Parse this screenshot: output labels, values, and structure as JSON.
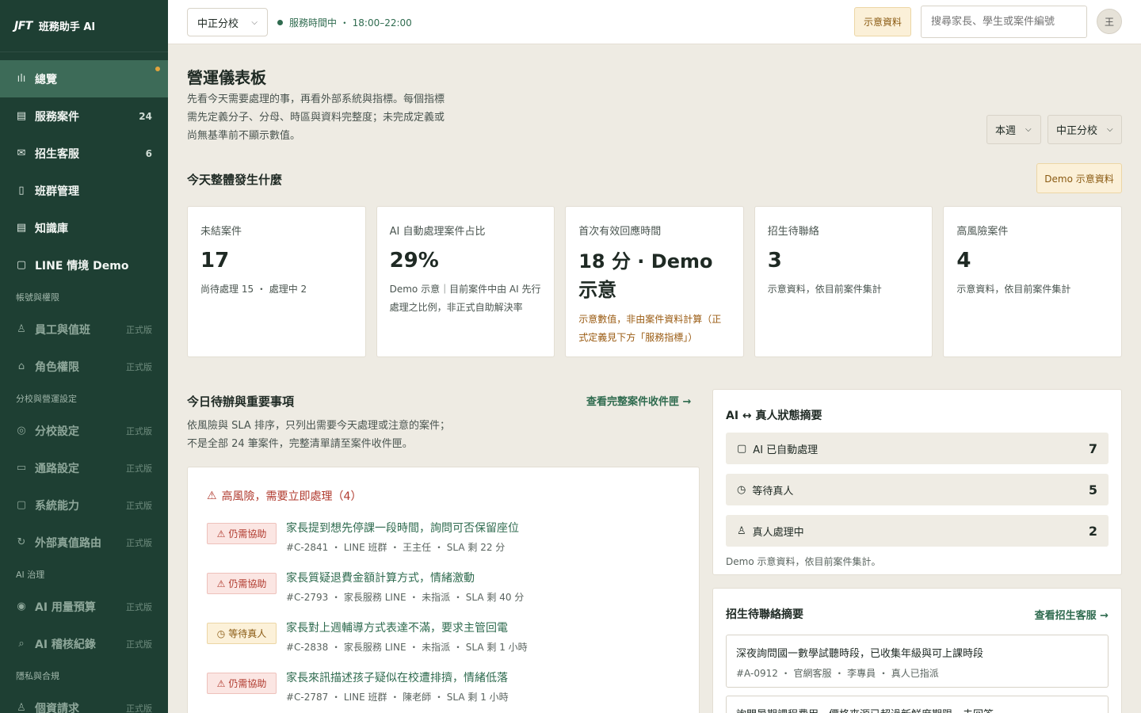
{
  "brand": {
    "logo": "JFT",
    "name": "班務助手 AI"
  },
  "nav": {
    "main": [
      {
        "icon": "ılı",
        "label": "總覽",
        "count": "",
        "active": true
      },
      {
        "icon": "▤",
        "label": "服務案件",
        "count": "24"
      },
      {
        "icon": "✉",
        "label": "招生客服",
        "count": "6"
      },
      {
        "icon": "▯",
        "label": "班群管理",
        "count": ""
      },
      {
        "icon": "▤",
        "label": "知識庫",
        "count": ""
      },
      {
        "icon": "▢",
        "label": "LINE 情境 Demo",
        "count": ""
      }
    ],
    "section_account": "帳號與權限",
    "account": [
      {
        "icon": "♙",
        "label": "員工與值班",
        "tag": "正式版"
      },
      {
        "icon": "🔒",
        "label": "角色權限",
        "tag": "正式版"
      }
    ],
    "section_branch": "分校與營運設定",
    "branch": [
      {
        "icon": "◎",
        "label": "分校設定",
        "tag": "正式版"
      },
      {
        "icon": "▭",
        "label": "通路設定",
        "tag": "正式版"
      },
      {
        "icon": "▢",
        "label": "系統能力",
        "tag": "正式版"
      },
      {
        "icon": "↻",
        "label": "外部真值路由",
        "tag": "正式版"
      }
    ],
    "section_ai": "AI 治理",
    "ai": [
      {
        "icon": "◉",
        "label": "AI 用量預算",
        "tag": "正式版"
      },
      {
        "icon": "⌕",
        "label": "AI 稽核紀錄",
        "tag": "正式版"
      }
    ],
    "section_privacy": "隱私與合規",
    "privacy": [
      {
        "icon": "♙",
        "label": "個資請求",
        "tag": "正式版"
      }
    ]
  },
  "topbar": {
    "branch": "中正分校",
    "service_status": "服務時間中 ・ 18:00–22:00",
    "demo_label": "示意資料",
    "search_placeholder": "搜尋家長、學生或案件編號",
    "avatar": "王"
  },
  "page": {
    "title": "營運儀表板",
    "desc": "先看今天需要處理的事，再看外部系統與指標。每個指標需先定義分子、分母、時區與資料完整度；未完成定義或尚無基準前不顯示數值。",
    "filter_week": "本週",
    "filter_branch": "中正分校"
  },
  "today": {
    "title": "今天整體發生什麼",
    "demo_tag": "Demo 示意資料",
    "kpis": [
      {
        "label": "未結案件",
        "value": "17",
        "note": "尚待處理 15 ・ 處理中 2"
      },
      {
        "label": "AI 自動處理案件占比",
        "value": "29%",
        "note": "Demo 示意｜目前案件中由 AI 先行處理之比例，非正式自助解決率"
      },
      {
        "label": "首次有效回應時間",
        "value": "18 分 · Demo 示意",
        "note": "示意數值，非由案件資料計算（正式定義見下方「服務指標」）"
      },
      {
        "label": "招生待聯絡",
        "value": "3",
        "note": "示意資料，依目前案件集計"
      },
      {
        "label": "高風險案件",
        "value": "4",
        "note": "示意資料，依目前案件集計"
      }
    ]
  },
  "todo": {
    "title": "今日待辦與重要事項",
    "link": "查看完整案件收件匣 →",
    "desc": "依風險與 SLA 排序，只列出需要今天處理或注意的案件；不是全部 24 筆案件，完整清單請至案件收件匣。",
    "risk_head": "高風險，需要立即處理（4）",
    "cases": [
      {
        "badge": "仍需協助",
        "badge_icon": "⚠",
        "type": "danger",
        "title": "家長提到想先停課一段時間，詢問可否保留座位",
        "meta": "#C-2841 ・ LINE 班群 ・ 王主任 ・ SLA 剩 22 分"
      },
      {
        "badge": "仍需協助",
        "badge_icon": "⚠",
        "type": "danger",
        "title": "家長質疑退費金額計算方式，情緒激動",
        "meta": "#C-2793 ・ 家長服務 LINE ・ 未指派 ・ SLA 剩 40 分"
      },
      {
        "badge": "等待真人",
        "badge_icon": "◷",
        "type": "wait",
        "title": "家長對上週輔導方式表達不滿，要求主管回電",
        "meta": "#C-2838 ・ 家長服務 LINE ・ 未指派 ・ SLA 剩 1 小時"
      },
      {
        "badge": "仍需協助",
        "badge_icon": "⚠",
        "type": "danger",
        "title": "家長來訊描述孩子疑似在校遭排擠，情緒低落",
        "meta": "#C-2787 ・ LINE 班群 ・ 陳老師 ・ SLA 剩 1 小時"
      }
    ]
  },
  "ai_summary": {
    "title": "AI ↔ 真人狀態摘要",
    "rows": [
      {
        "icon": "▢",
        "label": "AI 已自動處理",
        "value": "7"
      },
      {
        "icon": "◷",
        "label": "等待真人",
        "value": "5"
      },
      {
        "icon": "♙",
        "label": "真人處理中",
        "value": "2"
      }
    ],
    "foot": "Demo 示意資料，依目前案件集計。"
  },
  "enroll": {
    "title": "招生待聯絡摘要",
    "link": "查看招生客服 →",
    "items": [
      {
        "title": "深夜詢問國一數學試聽時段，已收集年級與可上課時段",
        "meta": "#A-0912 ・ 官網客服 ・ 李專員 ・ 真人已指派"
      },
      {
        "title": "詢問暑期課程費用，價格來源已超過新鮮度期限，未回答",
        "meta": ""
      }
    ]
  },
  "colors": {
    "sidebar": "#1e3f33",
    "accent": "#2f6b4f",
    "danger": "#b03a2e",
    "warn": "#8a5a12"
  }
}
